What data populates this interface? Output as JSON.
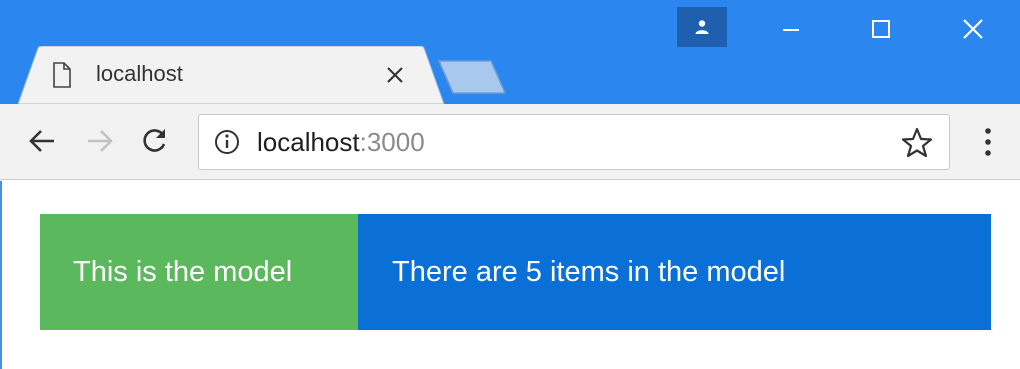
{
  "window": {
    "colors": {
      "titlebar": "#2b86f0",
      "toolbar": "#f2f2f2",
      "green": "#5cb85c",
      "blue": "#0a6fd6"
    }
  },
  "tab": {
    "title": "localhost",
    "icon": "page-icon",
    "close_icon": "close-icon"
  },
  "toolbar": {
    "back_icon": "back-arrow-icon",
    "forward_icon": "forward-arrow-icon",
    "reload_icon": "reload-icon",
    "info_icon": "info-icon",
    "url_host": "localhost",
    "url_port": ":3000",
    "bookmark_icon": "star-icon",
    "menu_icon": "kebab-menu-icon"
  },
  "content": {
    "model_label": "This is the model",
    "count_label": "There are 5 items in the model"
  }
}
